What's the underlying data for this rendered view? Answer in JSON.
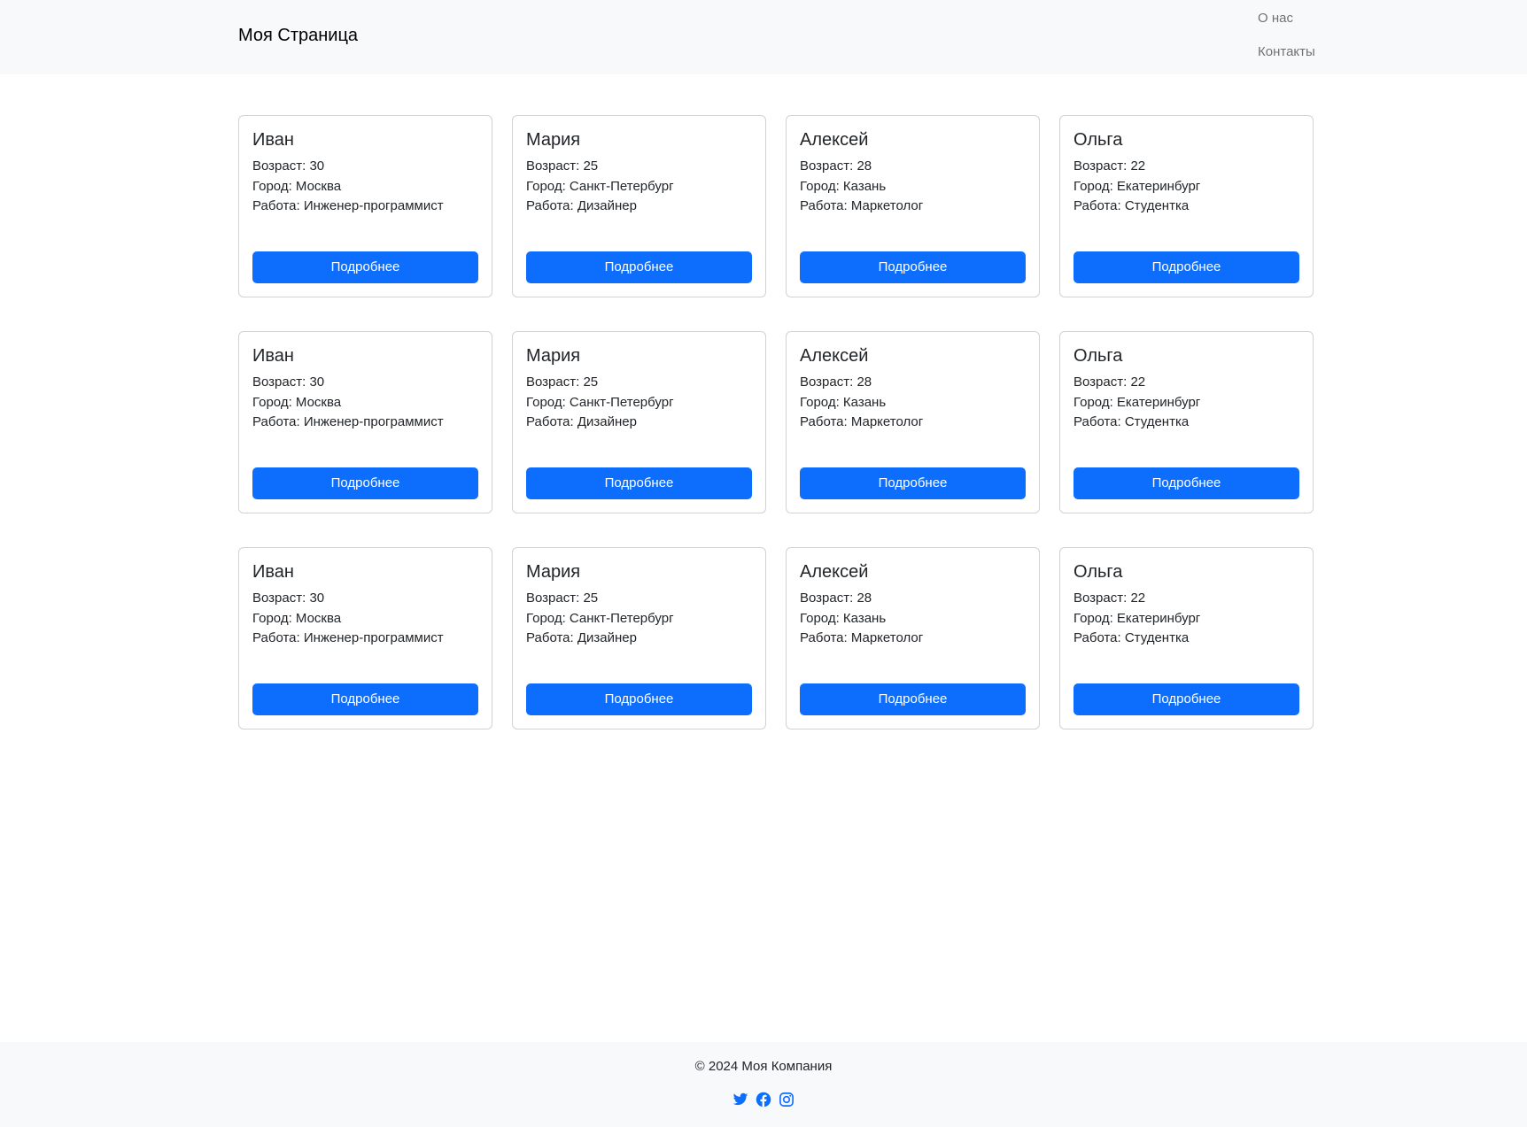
{
  "header": {
    "brand": "Моя Страница",
    "nav": [
      {
        "label": "О нас"
      },
      {
        "label": "Контакты"
      }
    ]
  },
  "cards": [
    {
      "name": "Иван",
      "age": "Возраст: 30",
      "city": "Город: Москва",
      "job": "Работа: Инженер-программист",
      "button": "Подробнее"
    },
    {
      "name": "Мария",
      "age": "Возраст: 25",
      "city": "Город: Санкт-Петербург",
      "job": "Работа: Дизайнер",
      "button": "Подробнее"
    },
    {
      "name": "Алексей",
      "age": "Возраст: 28",
      "city": "Город: Казань",
      "job": "Работа: Маркетолог",
      "button": "Подробнее"
    },
    {
      "name": "Ольга",
      "age": "Возраст: 22",
      "city": "Город: Екатеринбург",
      "job": "Работа: Студентка",
      "button": "Подробнее"
    },
    {
      "name": "Иван",
      "age": "Возраст: 30",
      "city": "Город: Москва",
      "job": "Работа: Инженер-программист",
      "button": "Подробнее"
    },
    {
      "name": "Мария",
      "age": "Возраст: 25",
      "city": "Город: Санкт-Петербург",
      "job": "Работа: Дизайнер",
      "button": "Подробнее"
    },
    {
      "name": "Алексей",
      "age": "Возраст: 28",
      "city": "Город: Казань",
      "job": "Работа: Маркетолог",
      "button": "Подробнее"
    },
    {
      "name": "Ольга",
      "age": "Возраст: 22",
      "city": "Город: Екатеринбург",
      "job": "Работа: Студентка",
      "button": "Подробнее"
    },
    {
      "name": "Иван",
      "age": "Возраст: 30",
      "city": "Город: Москва",
      "job": "Работа: Инженер-программист",
      "button": "Подробнее"
    },
    {
      "name": "Мария",
      "age": "Возраст: 25",
      "city": "Город: Санкт-Петербург",
      "job": "Работа: Дизайнер",
      "button": "Подробнее"
    },
    {
      "name": "Алексей",
      "age": "Возраст: 28",
      "city": "Город: Казань",
      "job": "Работа: Маркетолог",
      "button": "Подробнее"
    },
    {
      "name": "Ольга",
      "age": "Возраст: 22",
      "city": "Город: Екатеринбург",
      "job": "Работа: Студентка",
      "button": "Подробнее"
    }
  ],
  "footer": {
    "copyright": "© 2024 Моя Компания",
    "socials": [
      {
        "icon": "twitter-icon"
      },
      {
        "icon": "facebook-icon"
      },
      {
        "icon": "instagram-icon"
      }
    ]
  },
  "colors": {
    "primary": "#0d6efd",
    "navbar_bg": "#f8f9fa",
    "footer_bg": "#f8f9fa"
  }
}
